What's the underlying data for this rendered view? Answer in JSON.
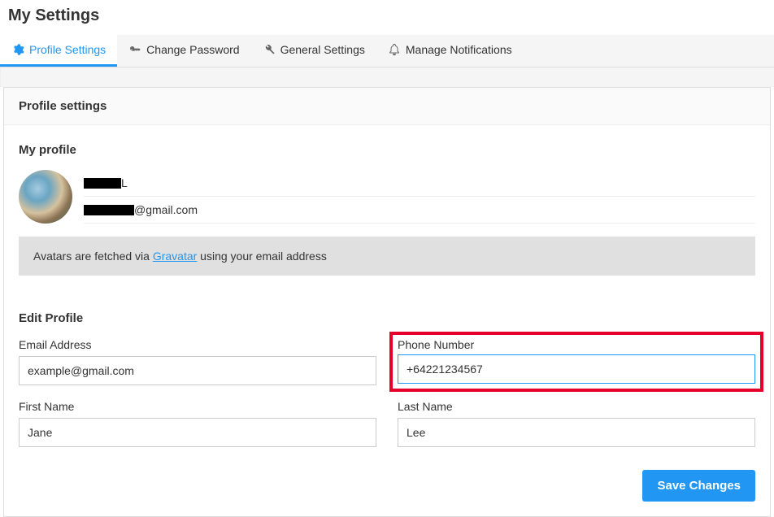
{
  "page_title": "My Settings",
  "tabs": [
    {
      "label": "Profile Settings"
    },
    {
      "label": "Change Password"
    },
    {
      "label": "General Settings"
    },
    {
      "label": "Manage Notifications"
    }
  ],
  "panel": {
    "header": "Profile settings",
    "my_profile_title": "My profile",
    "profile_name_suffix": " L",
    "profile_email_suffix": "@gmail.com",
    "banner_prefix": "Avatars are fetched via ",
    "banner_link": "Gravatar",
    "banner_suffix": " using your email address",
    "edit_title": "Edit Profile",
    "fields": {
      "email": {
        "label": "Email Address",
        "value": "example@gmail.com"
      },
      "phone": {
        "label": "Phone Number",
        "value": "+64221234567"
      },
      "first_name": {
        "label": "First Name",
        "value": "Jane"
      },
      "last_name": {
        "label": "Last Name",
        "value": "Lee"
      }
    },
    "save_button": "Save Changes"
  }
}
